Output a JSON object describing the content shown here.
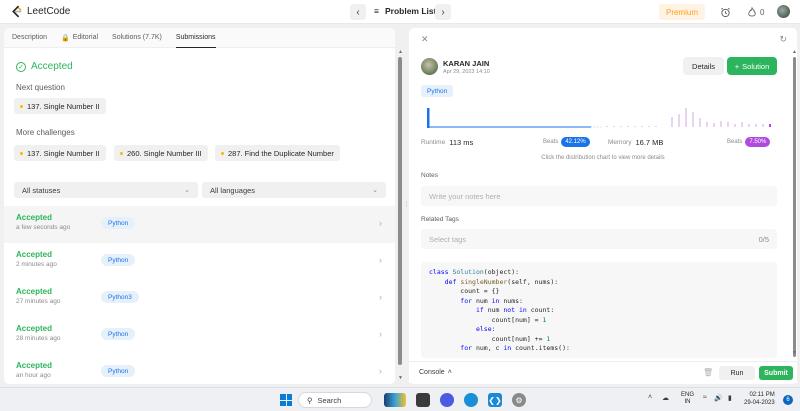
{
  "nav": {
    "logo_text": "LeetCode",
    "problem_list": "Problem List",
    "premium": "Premium",
    "fire_count": "0"
  },
  "left": {
    "tabs": [
      {
        "label": "Description"
      },
      {
        "label": "Editorial"
      },
      {
        "label": "Solutions (7.7K)"
      },
      {
        "label": "Submissions"
      }
    ],
    "accepted_title": "Accepted",
    "next_question_label": "Next question",
    "next_question": "137. Single Number II",
    "more_challenges_label": "More challenges",
    "challenges": [
      "137. Single Number II",
      "260. Single Number III",
      "287. Find the Duplicate Number"
    ],
    "filter_status": "All statuses",
    "filter_lang": "All languages",
    "submissions": [
      {
        "status": "Accepted",
        "time": "a few seconds ago",
        "lang": "Python"
      },
      {
        "status": "Accepted",
        "time": "2 minutes ago",
        "lang": "Python"
      },
      {
        "status": "Accepted",
        "time": "27 minutes ago",
        "lang": "Python3"
      },
      {
        "status": "Accepted",
        "time": "28 minutes ago",
        "lang": "Python"
      },
      {
        "status": "Accepted",
        "time": "an hour ago",
        "lang": "Python"
      }
    ]
  },
  "right": {
    "user_name": "KARAN JAIN",
    "user_date": "Apr 29, 2023 14:10",
    "details": "Details",
    "solution": "Solution",
    "lang": "Python",
    "runtime_label": "Runtime",
    "runtime_value": "113 ms",
    "runtime_beats_label": "Beats",
    "runtime_beats": "42.12%",
    "memory_label": "Memory",
    "memory_value": "16.7 MB",
    "memory_beats_label": "Beats",
    "memory_beats": "7.50%",
    "chart_hint": "Click the distribution chart to view more details",
    "notes_label": "Notes",
    "notes_placeholder": "Write your notes here",
    "tags_label": "Related Tags",
    "tags_placeholder": "Select tags",
    "tags_count": "0/5",
    "code": [
      [
        {
          "t": "class ",
          "c": "kw"
        },
        {
          "t": "Solution",
          "c": "cls"
        },
        {
          "t": "(object):",
          "c": "plain"
        }
      ],
      [
        {
          "t": "    def ",
          "c": "kw"
        },
        {
          "t": "singleNumber",
          "c": "fn"
        },
        {
          "t": "(self, nums):",
          "c": "plain"
        }
      ],
      [
        {
          "t": "        count = {}",
          "c": "plain"
        }
      ],
      [
        {
          "t": "        for ",
          "c": "kw"
        },
        {
          "t": "num ",
          "c": "plain"
        },
        {
          "t": "in ",
          "c": "kw"
        },
        {
          "t": "nums:",
          "c": "plain"
        }
      ],
      [
        {
          "t": "            if ",
          "c": "kw"
        },
        {
          "t": "num ",
          "c": "plain"
        },
        {
          "t": "not in ",
          "c": "kw"
        },
        {
          "t": "count:",
          "c": "plain"
        }
      ],
      [
        {
          "t": "                count[num] = ",
          "c": "plain"
        },
        {
          "t": "1",
          "c": "num"
        }
      ],
      [
        {
          "t": "            else:",
          "c": "kw"
        }
      ],
      [
        {
          "t": "                count[num] += ",
          "c": "plain"
        },
        {
          "t": "1",
          "c": "num"
        }
      ],
      [
        {
          "t": "        for ",
          "c": "kw"
        },
        {
          "t": "num, c ",
          "c": "plain"
        },
        {
          "t": "in ",
          "c": "kw"
        },
        {
          "t": "count.items():",
          "c": "plain"
        }
      ]
    ],
    "console": "Console",
    "run": "Run",
    "submit": "Submit"
  },
  "taskbar": {
    "search": "Search",
    "lang_line1": "ENG",
    "lang_line2": "IN",
    "time": "02:11 PM",
    "date": "29-04-2023",
    "notif_count": "6"
  },
  "colors": {
    "accent_green": "#2db55d",
    "runtime_blue": "#1a73e8",
    "memory_purple": "#b04adf",
    "premium_orange": "#ffa116"
  }
}
